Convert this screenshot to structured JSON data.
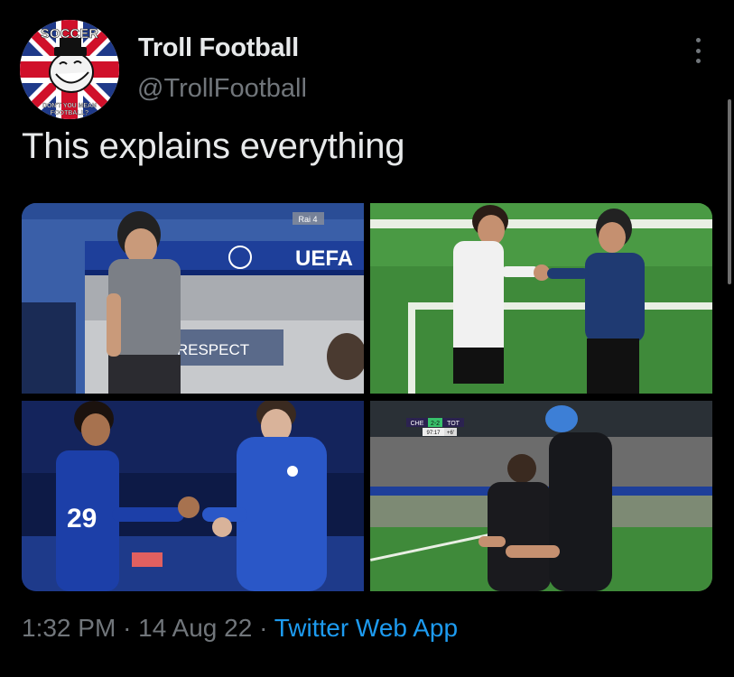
{
  "account": {
    "display_name": "Troll Football",
    "handle": "@TrollFootball",
    "avatar_text_top": "SOCCER",
    "avatar_text_bottom": "DON'T YOU MEAN FOOTBALL?"
  },
  "tweet": {
    "text": "This explains everything",
    "time": "1:32 PM",
    "separator": "·",
    "date": "14 Aug 22",
    "source": "Twitter Web App"
  },
  "media": {
    "tile1": {
      "banner_text": "UEFA",
      "board_text": "RESPECT",
      "channel": "Rai 4"
    },
    "tile2": {},
    "tile3": {
      "shirt_number": "29"
    },
    "tile4": {
      "scoreboard": {
        "home": "CHE",
        "score": "2-2",
        "away": "TOT",
        "clock": "97:17",
        "added": "+6'"
      }
    }
  },
  "icons": {
    "more": "more-vertical-icon"
  },
  "colors": {
    "link": "#1d9bf0",
    "muted": "#71767b",
    "text": "#e7e9ea",
    "background": "#000000"
  }
}
